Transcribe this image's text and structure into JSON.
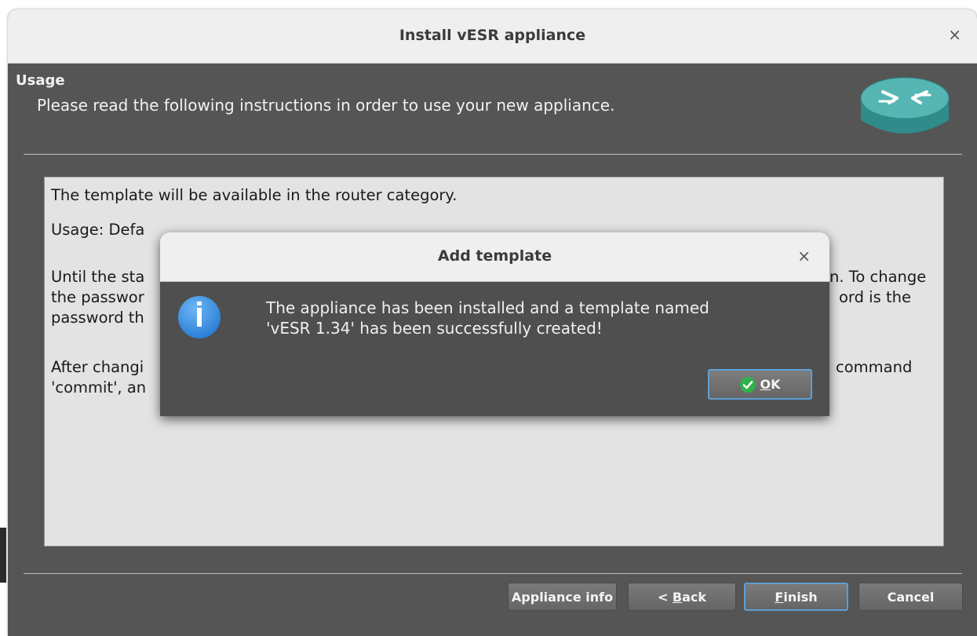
{
  "window": {
    "title": "Install vESR appliance",
    "close_glyph": "×"
  },
  "header": {
    "title": "Usage",
    "subtitle": "Please read the following instructions in order to use your new appliance.",
    "icon": "router-icon"
  },
  "content": {
    "lines": [
      "The template will be available in the router category.",
      "Usage: Defa",
      "Until the sta",
      "the passwor",
      "password th",
      "After changi",
      "'commit', an"
    ],
    "right_fragments": [
      "n. To change",
      "ord is the",
      "command"
    ]
  },
  "buttons": {
    "appliance_info": "Appliance info",
    "back_arrow": "< ",
    "back_underlined": "B",
    "back_rest": "ack",
    "finish_underlined": "F",
    "finish_rest": "inish",
    "cancel": "Cancel"
  },
  "dialog": {
    "title": "Add template",
    "close_glyph": "×",
    "message_line1": "The appliance has been installed and a template named",
    "message_line2": "'vESR 1.34' has been successfully created!",
    "ok_underlined": "O",
    "ok_rest": "K",
    "icon": "info-icon"
  },
  "colors": {
    "window_bg": "#555555",
    "content_bg": "#e3e3e3",
    "accent_border": "#5d9fd6",
    "info_icon": "#3a8ee6",
    "check_green": "#2fb34a"
  }
}
